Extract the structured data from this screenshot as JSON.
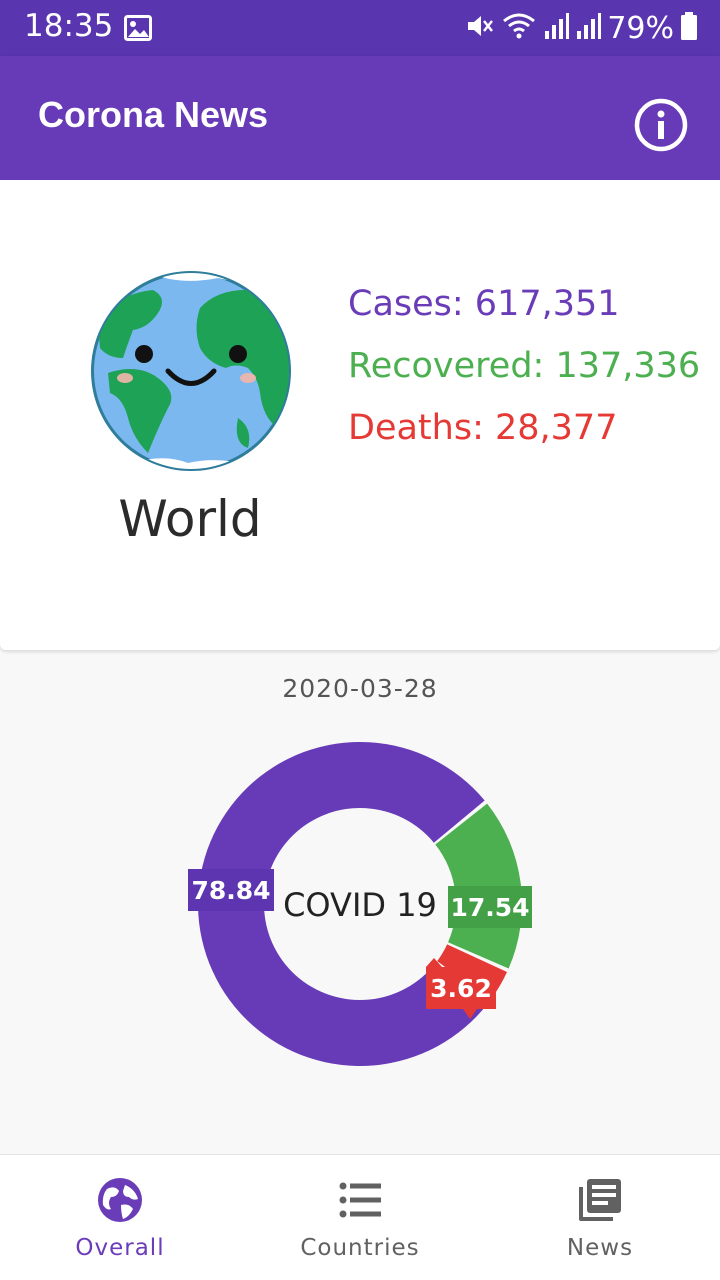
{
  "status_bar": {
    "time": "18:35",
    "battery": "79%"
  },
  "app_bar": {
    "title": "Corona News"
  },
  "summary": {
    "region": "World",
    "cases": "Cases: 617,351",
    "recovered": "Recovered: 137,336",
    "deaths": "Deaths: 28,377"
  },
  "chart": {
    "date": "2020-03-28"
  },
  "chart_data": {
    "type": "pie",
    "variant": "donut",
    "center_label": "COVID 19",
    "categories": [
      "Cases",
      "Recovered",
      "Deaths"
    ],
    "values": [
      78.84,
      17.54,
      3.62
    ],
    "labels": [
      "78.84",
      "17.54",
      "3.62"
    ],
    "colors": [
      "#673ab7",
      "#4caf50",
      "#e53935"
    ],
    "label_colors": [
      "#5e35b1",
      "#43a047",
      "#e53935"
    ]
  },
  "colors": {
    "primary": "#673ab7",
    "status_bar": "#5a35b0",
    "green": "#4caf50",
    "red": "#e53935",
    "nav_active": "#6a3cb8",
    "nav_inactive": "#616161"
  },
  "bottom_nav": {
    "items": [
      {
        "label": "Overall",
        "icon": "globe-icon",
        "active": true
      },
      {
        "label": "Countries",
        "icon": "list-icon",
        "active": false
      },
      {
        "label": "News",
        "icon": "news-icon",
        "active": false
      }
    ]
  }
}
